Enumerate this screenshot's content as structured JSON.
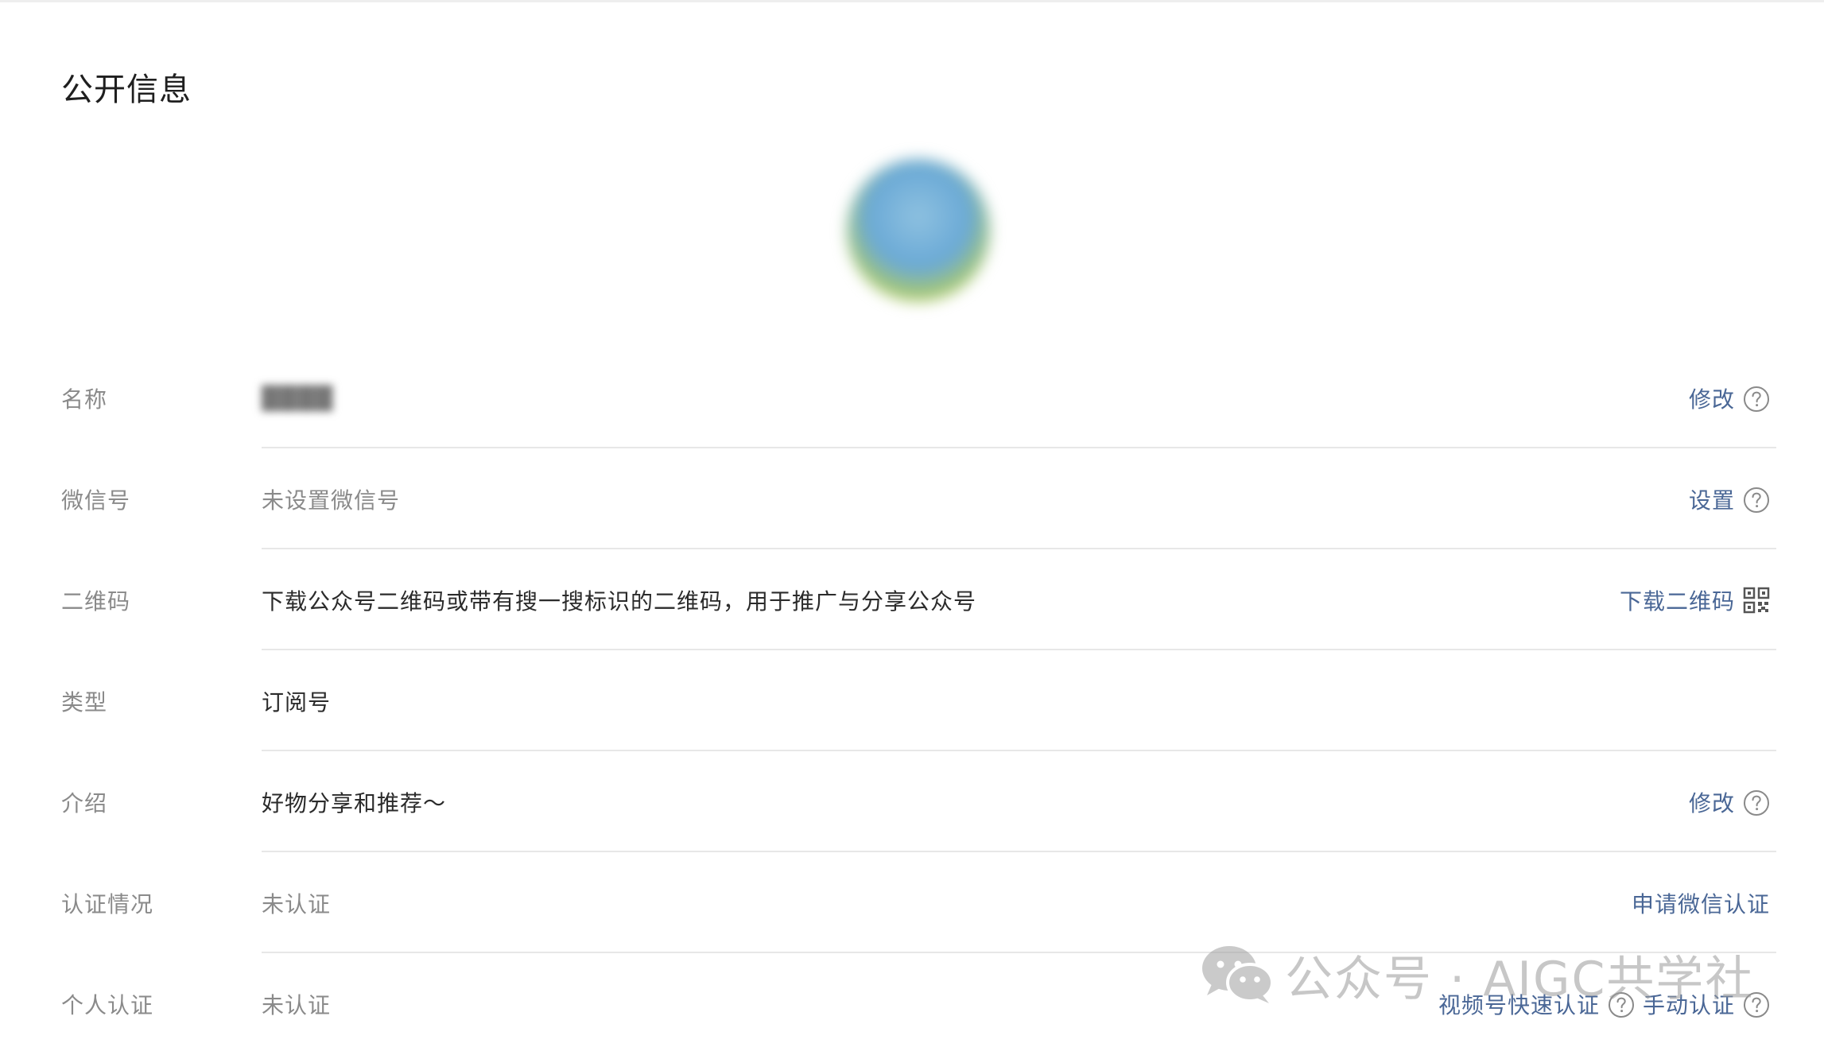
{
  "section": {
    "title": "公开信息"
  },
  "rows": [
    {
      "label": "名称",
      "value": "████",
      "action": "修改"
    },
    {
      "label": "微信号",
      "value": "未设置微信号",
      "action": "设置"
    },
    {
      "label": "二维码",
      "value": "下载公众号二维码或带有搜一搜标识的二维码，用于推广与分享公众号",
      "action": "下载二维码"
    },
    {
      "label": "类型",
      "value": "订阅号"
    },
    {
      "label": "介绍",
      "value": "好物分享和推荐～",
      "action": "修改"
    },
    {
      "label": "认证情况",
      "value": "未认证",
      "action": "申请微信认证"
    },
    {
      "label": "个人认证",
      "value": "未认证",
      "action": "视频号快速认证",
      "action2": "手动认证"
    }
  ],
  "watermark": {
    "text": "公众号 · AIGC共学社"
  },
  "icons": {
    "help": "question-circle-icon",
    "qr": "qr-code-icon",
    "wechat": "wechat-logo-icon"
  },
  "colors": {
    "link": "#4a6796",
    "label": "#8a8a8a",
    "text": "#2b2b2b",
    "divider": "#e7e7e7"
  }
}
